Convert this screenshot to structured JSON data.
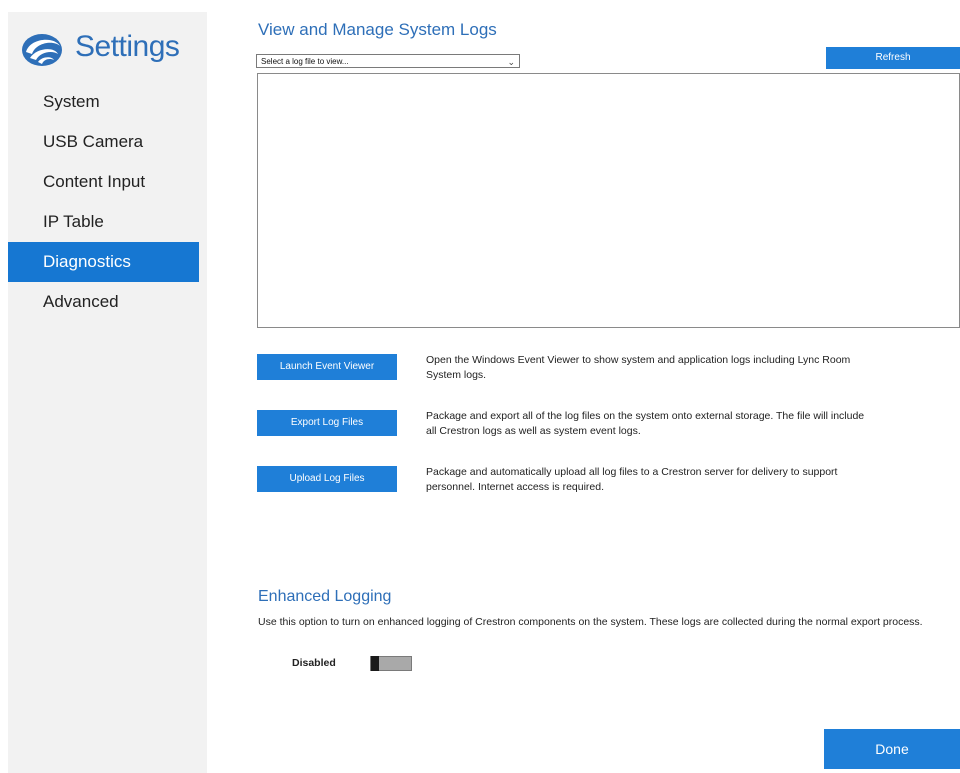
{
  "sidebar": {
    "app_title": "Settings",
    "logo_icon": "crestron-swirl-icon",
    "items": [
      {
        "label": "System",
        "active": false
      },
      {
        "label": "USB Camera",
        "active": false
      },
      {
        "label": "Content Input",
        "active": false
      },
      {
        "label": "IP Table",
        "active": false
      },
      {
        "label": "Diagnostics",
        "active": true
      },
      {
        "label": "Advanced",
        "active": false
      }
    ]
  },
  "logs": {
    "title": "View and Manage System Logs",
    "select_placeholder": "Select a log file to view...",
    "refresh_label": "Refresh",
    "log_content": ""
  },
  "actions": [
    {
      "button": "Launch Event Viewer",
      "description": "Open the Windows Event Viewer to show system and application logs including Lync Room System logs."
    },
    {
      "button": "Export Log Files",
      "description": "Package and export all of the log files on the system onto external storage.  The file will include all Crestron logs as well as system event logs."
    },
    {
      "button": "Upload Log Files",
      "description": "Package and automatically upload all log files to a Crestron server for delivery to support personnel.  Internet access is required."
    }
  ],
  "enhanced_logging": {
    "title": "Enhanced Logging",
    "description": "Use this option to turn on enhanced logging of Crestron components on the system.  These logs are collected during the normal export process.",
    "toggle_label": "Disabled",
    "enabled": false
  },
  "footer": {
    "done_label": "Done"
  },
  "colors": {
    "accent": "#1f7fd8",
    "title_blue": "#2e6fb8",
    "sidebar_bg": "#f2f2f2"
  }
}
